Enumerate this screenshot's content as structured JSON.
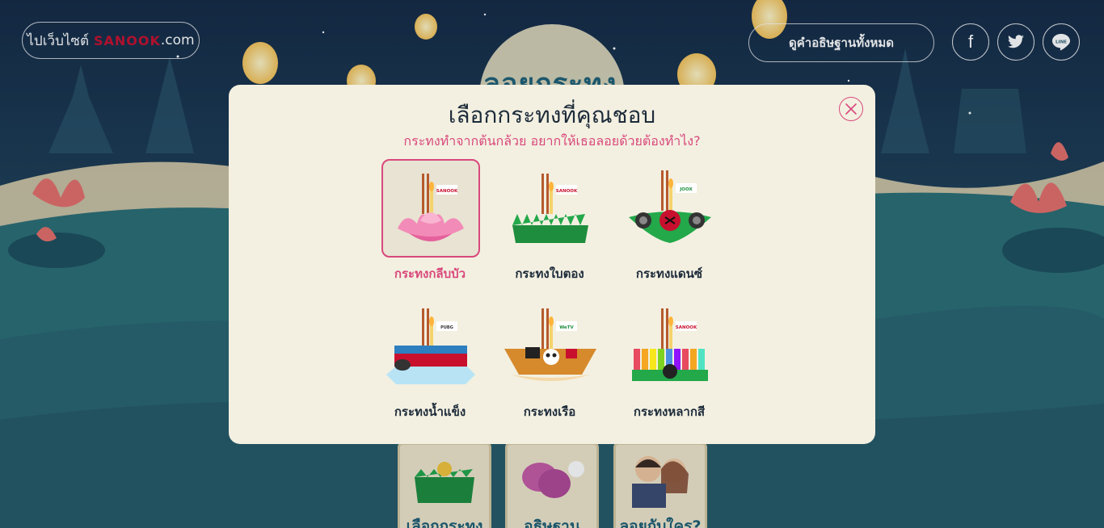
{
  "header": {
    "site_prefix": "ไปเว็บไซต์",
    "site_brand": "SANOOK",
    "site_tld": ".com",
    "all_wishes": "ดูคำอธิษฐานทั้งหมด"
  },
  "social": {
    "facebook": "f",
    "twitter": "twitter-bird",
    "line": "LINE"
  },
  "backdrop": {
    "title": "ลอยกระทง",
    "cards": [
      {
        "label": "เลือกกระทง"
      },
      {
        "label": "อธิษฐาน"
      },
      {
        "label": "ลอยกับใคร?"
      }
    ]
  },
  "modal": {
    "title": "เลือกกระทงที่คุณชอบ",
    "subtitle": "กระทงทำจากต้นกล้วย อยากให้เธอลอยด้วยต้องทำไง?",
    "options": [
      {
        "name": "กระทงกลีบบัว",
        "selected": true,
        "flag": "SANOOK"
      },
      {
        "name": "กระทงใบตอง",
        "selected": false,
        "flag": "SANOOK"
      },
      {
        "name": "กระทงแดนซ์",
        "selected": false,
        "flag": "JOOX"
      },
      {
        "name": "กระทงน้ำแข็ง",
        "selected": false,
        "flag": "PUBG"
      },
      {
        "name": "กระทงเรือ",
        "selected": false,
        "flag": "WeTV"
      },
      {
        "name": "กระทงหลากสี",
        "selected": false,
        "flag": "SANOOK"
      }
    ]
  },
  "colors": {
    "accent_pink": "#d9487c",
    "modal_bg": "#f3f0e1",
    "text_dark": "#1d2b3a"
  }
}
